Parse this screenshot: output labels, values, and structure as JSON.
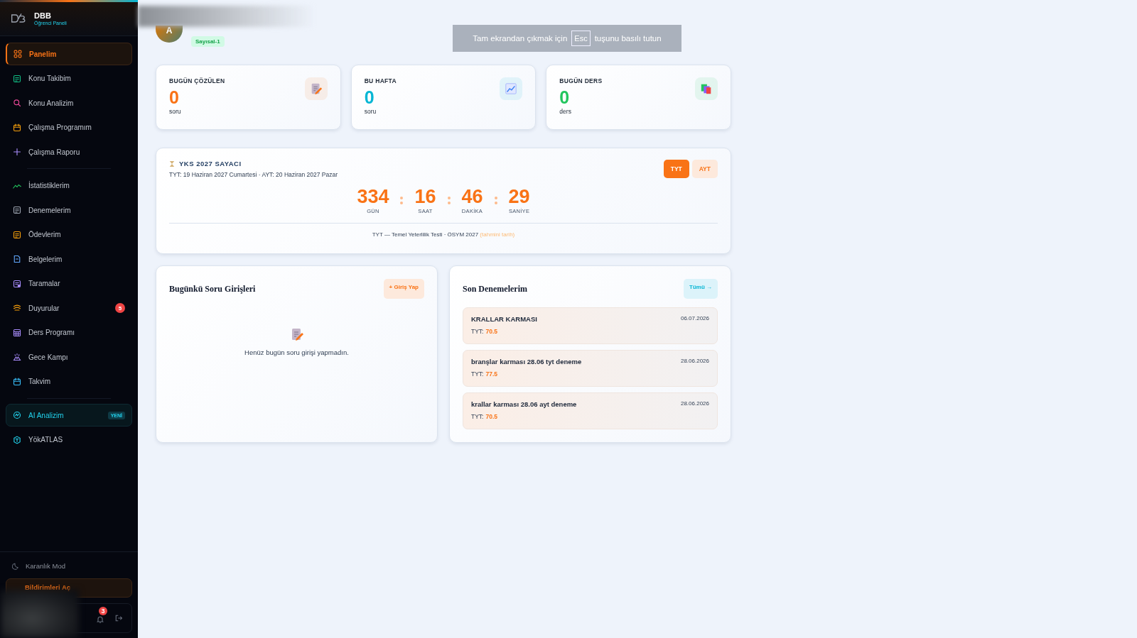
{
  "sidebar": {
    "logo": {
      "title": "DBB",
      "subtitle": "Öğrenci Paneli"
    },
    "sections": [
      {
        "items": [
          {
            "label": "Panelim",
            "selected": true
          },
          {
            "label": "Konu Takibim",
            "selected": false
          },
          {
            "label": "Konu Analizim",
            "selected": false
          },
          {
            "label": "Çalışma Programım",
            "selected": false
          },
          {
            "label": "Çalışma Raporu",
            "selected": false
          }
        ]
      },
      {
        "items": [
          {
            "label": "İstatistiklerim",
            "selected": false
          },
          {
            "label": "Denemelerim",
            "selected": false
          },
          {
            "label": "Ödevlerim",
            "selected": false
          },
          {
            "label": "Belgelerim",
            "selected": false
          },
          {
            "label": "Taramalar",
            "selected": false
          },
          {
            "label": "Duyurular",
            "selected": false,
            "badge": "5"
          },
          {
            "label": "Ders Programı",
            "selected": false
          },
          {
            "label": "Gece Kampı",
            "selected": false
          },
          {
            "label": "Takvim",
            "selected": false
          }
        ]
      },
      {
        "items": [
          {
            "label": "AI Analizim",
            "selected": false,
            "tag": "YENİ"
          },
          {
            "label": "YökATLAS",
            "selected": false
          }
        ]
      }
    ],
    "dark_mode": "Karanlık Mod",
    "notifications_button": "Bildirimleri Aç",
    "notification_count": "3"
  },
  "header": {
    "avatar_letter": "A",
    "track": "Sayısal-1"
  },
  "fullscreen_notice": {
    "before": "Tam ekrandan çıkmak için",
    "key": "Esc",
    "after": "tuşunu basılı tutun"
  },
  "stats": [
    {
      "label": "BUGÜN ÇÖZÜLEN",
      "value": "0",
      "unit": "soru",
      "color": "#f97316"
    },
    {
      "label": "BU HAFTA",
      "value": "0",
      "unit": "soru",
      "color": "#06b6d4"
    },
    {
      "label": "BUGÜN DERS",
      "value": "0",
      "unit": "ders",
      "color": "#22c55e"
    }
  ],
  "countdown": {
    "title": "YKS 2027 SAYACI",
    "subtitle": "TYT: 19 Haziran 2027 Cumartesi · AYT: 20 Haziran 2027 Pazar",
    "tabs": [
      {
        "label": "TYT",
        "selected": true
      },
      {
        "label": "AYT",
        "selected": false
      }
    ],
    "units": [
      {
        "value": "334",
        "label": "GÜN"
      },
      {
        "value": "16",
        "label": "SAAT"
      },
      {
        "value": "46",
        "label": "DAKİKA"
      },
      {
        "value": "29",
        "label": "SANİYE"
      }
    ],
    "footer": "TYT — Temel Yeterlilik Testi · ÖSYM 2027",
    "footer_note": "(tahmini tarih)"
  },
  "entries": {
    "title": "Bugünkü Soru Girişleri",
    "button": "+ Giriş Yap",
    "empty_message": "Henüz bugün soru girişi yapmadın."
  },
  "exams": {
    "title": "Son Denemelerim",
    "button": "Tümü →",
    "items": [
      {
        "name": "KRALLAR KARMASI",
        "date": "06.07.2026",
        "score_label": "TYT:",
        "score": "70.5"
      },
      {
        "name": "branşlar karması 28.06 tyt deneme",
        "date": "28.06.2026",
        "score_label": "TYT:",
        "score": "77.5"
      },
      {
        "name": "krallar karması 28.06 ayt deneme",
        "date": "28.06.2026",
        "score_label": "TYT:",
        "score": "70.5"
      }
    ]
  }
}
